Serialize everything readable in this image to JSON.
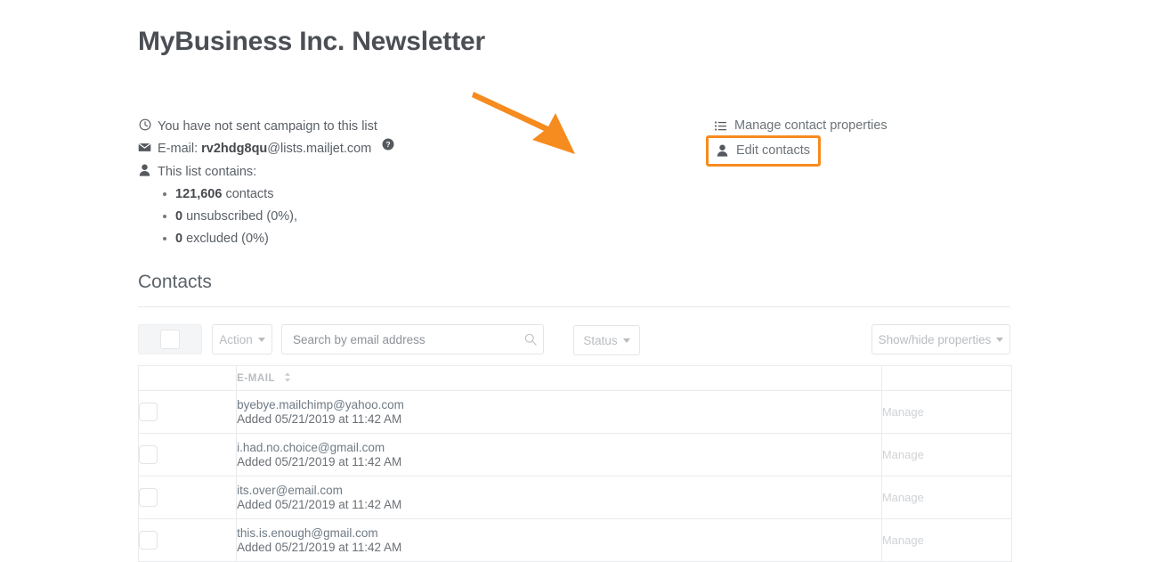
{
  "header": {
    "title": "MyBusiness Inc. Newsletter"
  },
  "info": {
    "campaign_status": "You have not sent campaign to this list",
    "email_label": "E-mail:",
    "email_local": "rv2hdg8qu",
    "email_domain": "@lists.mailjet.com",
    "help_icon": "help-circle-icon",
    "clock_icon": "clock-icon",
    "envelope_icon": "envelope-icon",
    "person_icon": "person-icon",
    "contains_label": "This list contains:",
    "stats": [
      {
        "value": "121,606",
        "label": "contacts"
      },
      {
        "value": "0",
        "label": "unsubscribed (0%),"
      },
      {
        "value": "0",
        "label": "excluded (0%)"
      }
    ]
  },
  "actions": {
    "manage_properties": "Manage contact properties",
    "manage_properties_icon": "list-icon",
    "edit_contacts": "Edit contacts",
    "edit_contacts_icon": "person-icon",
    "highlight_color": "#f68b1f",
    "annotation": "orange-arrow-pointing-to-edit-contacts"
  },
  "contacts_section": {
    "title": "Contacts",
    "toolbar": {
      "select_all_checkbox": "select-all",
      "action_label": "Action",
      "search_placeholder": "Search by email address",
      "search_value": "",
      "search_icon": "search-icon",
      "status_label": "Status",
      "show_hide_properties_label": "Show/hide properties"
    },
    "table": {
      "columns": [
        "",
        "E-MAIL",
        ""
      ],
      "sort_icon": "sort-updown-icon",
      "manage_label": "Manage",
      "rows": [
        {
          "email": "byebye.mailchimp@yahoo.com",
          "added": "Added 05/21/2019 at 11:42 AM",
          "manage": "Manage"
        },
        {
          "email": "i.had.no.choice@gmail.com",
          "added": "Added 05/21/2019 at 11:42 AM",
          "manage": "Manage"
        },
        {
          "email": "its.over@email.com",
          "added": "Added 05/21/2019 at 11:42 AM",
          "manage": "Manage"
        },
        {
          "email": "this.is.enough@gmail.com",
          "added": "Added 05/21/2019 at 11:42 AM",
          "manage": "Manage"
        }
      ]
    }
  }
}
